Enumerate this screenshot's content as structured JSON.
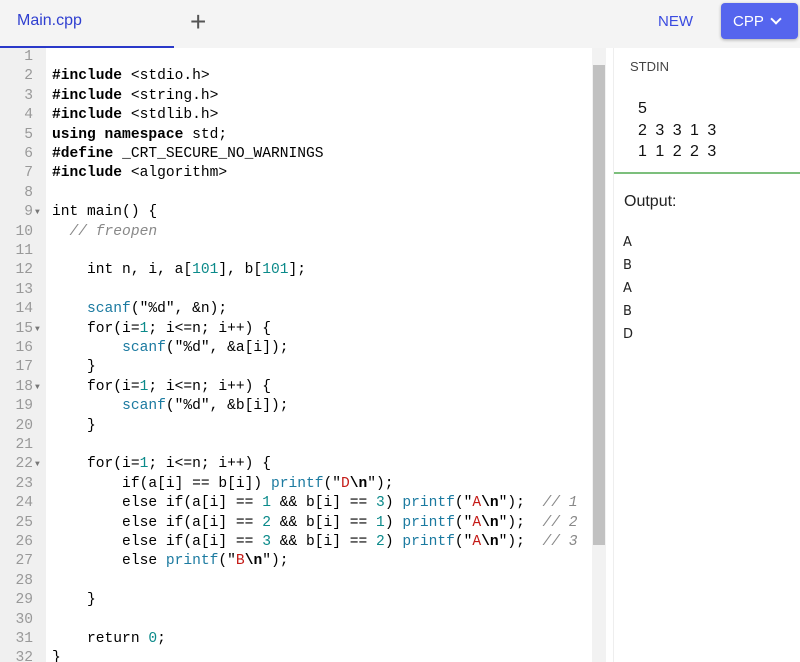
{
  "tabs": {
    "active": "Main.cpp",
    "add": "+"
  },
  "toolbar": {
    "new_label": "NEW",
    "language": "CPP"
  },
  "editor": {
    "lines": [
      {
        "n": "1",
        "fold": false,
        "t": []
      },
      {
        "n": "2",
        "fold": false,
        "t": [
          [
            "#include",
            "kw"
          ],
          [
            " <stdio.h>",
            ""
          ]
        ]
      },
      {
        "n": "3",
        "fold": false,
        "t": [
          [
            "#include",
            "kw"
          ],
          [
            " <string.h>",
            ""
          ]
        ]
      },
      {
        "n": "4",
        "fold": false,
        "t": [
          [
            "#include",
            "kw"
          ],
          [
            " <stdlib.h>",
            ""
          ]
        ]
      },
      {
        "n": "5",
        "fold": false,
        "t": [
          [
            "using namespace",
            "kw"
          ],
          [
            " std;",
            ""
          ]
        ]
      },
      {
        "n": "6",
        "fold": false,
        "t": [
          [
            "#define",
            "kw"
          ],
          [
            " _CRT_SECURE_NO_WARNINGS",
            ""
          ]
        ]
      },
      {
        "n": "7",
        "fold": false,
        "t": [
          [
            "#include",
            "kw"
          ],
          [
            " <algorithm>",
            ""
          ]
        ]
      },
      {
        "n": "8",
        "fold": false,
        "t": []
      },
      {
        "n": "9",
        "fold": true,
        "t": [
          [
            "int main() {",
            ""
          ]
        ]
      },
      {
        "n": "10",
        "fold": false,
        "t": [
          [
            "  ",
            ""
          ],
          [
            "// freopen",
            "cm"
          ]
        ]
      },
      {
        "n": "11",
        "fold": false,
        "t": []
      },
      {
        "n": "12",
        "fold": false,
        "t": [
          [
            "    int n, i, a[",
            ""
          ],
          [
            "101",
            "num"
          ],
          [
            "], b[",
            ""
          ],
          [
            "101",
            "num"
          ],
          [
            "];",
            ""
          ]
        ]
      },
      {
        "n": "13",
        "fold": false,
        "t": []
      },
      {
        "n": "14",
        "fold": false,
        "t": [
          [
            "    ",
            ""
          ],
          [
            "scanf",
            "fn"
          ],
          [
            "(\"%d\", &n);",
            ""
          ]
        ]
      },
      {
        "n": "15",
        "fold": true,
        "t": [
          [
            "    for(i=",
            ""
          ],
          [
            "1",
            "num"
          ],
          [
            "; i<=n; i++) {",
            ""
          ]
        ]
      },
      {
        "n": "16",
        "fold": false,
        "t": [
          [
            "        ",
            ""
          ],
          [
            "scanf",
            "fn"
          ],
          [
            "(\"%d\", &a[i]);",
            ""
          ]
        ]
      },
      {
        "n": "17",
        "fold": false,
        "t": [
          [
            "    }",
            ""
          ]
        ]
      },
      {
        "n": "18",
        "fold": true,
        "t": [
          [
            "    for(i=",
            ""
          ],
          [
            "1",
            "num"
          ],
          [
            "; i<=n; i++) {",
            ""
          ]
        ]
      },
      {
        "n": "19",
        "fold": false,
        "t": [
          [
            "        ",
            ""
          ],
          [
            "scanf",
            "fn"
          ],
          [
            "(\"%d\", &b[i]);",
            ""
          ]
        ]
      },
      {
        "n": "20",
        "fold": false,
        "t": [
          [
            "    }",
            ""
          ]
        ]
      },
      {
        "n": "21",
        "fold": false,
        "t": []
      },
      {
        "n": "22",
        "fold": true,
        "t": [
          [
            "    for(i=",
            ""
          ],
          [
            "1",
            "num"
          ],
          [
            "; i<=n; i++) {",
            ""
          ]
        ]
      },
      {
        "n": "23",
        "fold": false,
        "t": [
          [
            "        if(a[i] == b[i]) ",
            ""
          ],
          [
            "printf",
            "fn"
          ],
          [
            "(\"",
            ""
          ],
          [
            "D",
            "str"
          ],
          [
            "\\n",
            "esc"
          ],
          [
            "\");",
            ""
          ]
        ]
      },
      {
        "n": "24",
        "fold": false,
        "t": [
          [
            "        else if(a[i] == ",
            ""
          ],
          [
            "1",
            "num"
          ],
          [
            " && b[i] == ",
            ""
          ],
          [
            "3",
            "num"
          ],
          [
            ") ",
            ""
          ],
          [
            "printf",
            "fn"
          ],
          [
            "(\"",
            ""
          ],
          [
            "A",
            "str"
          ],
          [
            "\\n",
            "esc"
          ],
          [
            "\");  ",
            ""
          ],
          [
            "// 1",
            "cm"
          ]
        ]
      },
      {
        "n": "25",
        "fold": false,
        "t": [
          [
            "        else if(a[i] == ",
            ""
          ],
          [
            "2",
            "num"
          ],
          [
            " && b[i] == ",
            ""
          ],
          [
            "1",
            "num"
          ],
          [
            ") ",
            ""
          ],
          [
            "printf",
            "fn"
          ],
          [
            "(\"",
            ""
          ],
          [
            "A",
            "str"
          ],
          [
            "\\n",
            "esc"
          ],
          [
            "\");  ",
            ""
          ],
          [
            "// 2",
            "cm"
          ]
        ]
      },
      {
        "n": "26",
        "fold": false,
        "t": [
          [
            "        else if(a[i] == ",
            ""
          ],
          [
            "3",
            "num"
          ],
          [
            " && b[i] == ",
            ""
          ],
          [
            "2",
            "num"
          ],
          [
            ") ",
            ""
          ],
          [
            "printf",
            "fn"
          ],
          [
            "(\"",
            ""
          ],
          [
            "A",
            "str"
          ],
          [
            "\\n",
            "esc"
          ],
          [
            "\");  ",
            ""
          ],
          [
            "// 3",
            "cm"
          ]
        ]
      },
      {
        "n": "27",
        "fold": false,
        "t": [
          [
            "        else ",
            ""
          ],
          [
            "printf",
            "fn"
          ],
          [
            "(\"",
            ""
          ],
          [
            "B",
            "str"
          ],
          [
            "\\n",
            "esc"
          ],
          [
            "\");",
            ""
          ]
        ]
      },
      {
        "n": "28",
        "fold": false,
        "t": []
      },
      {
        "n": "29",
        "fold": false,
        "t": [
          [
            "    }",
            ""
          ]
        ]
      },
      {
        "n": "30",
        "fold": false,
        "t": []
      },
      {
        "n": "31",
        "fold": false,
        "t": [
          [
            "    return ",
            ""
          ],
          [
            "0",
            "num"
          ],
          [
            ";",
            ""
          ]
        ]
      },
      {
        "n": "32",
        "fold": false,
        "t": [
          [
            "}",
            ""
          ]
        ]
      }
    ]
  },
  "stdin": {
    "label": "STDIN",
    "value": "5\n2 3 3 1 3\n1 1 2 2 3"
  },
  "output": {
    "label": "Output:",
    "lines": [
      "A",
      "B",
      "A",
      "B",
      "D"
    ]
  }
}
